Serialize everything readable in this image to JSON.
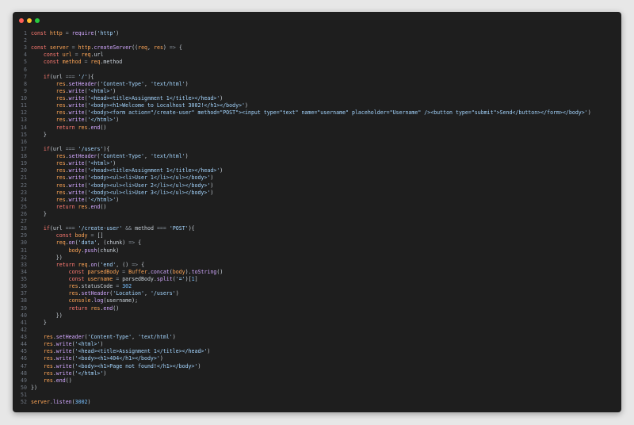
{
  "window": {
    "controls": {
      "close_color": "#ff5f56",
      "minimize_color": "#ffbd2e",
      "maximize_color": "#27c93f"
    }
  },
  "editor": {
    "lines": [
      "const http = require('http')",
      "",
      "const server = http.createServer((req, res) => {",
      "    const url = req.url",
      "    const method = req.method",
      "",
      "    if(url === '/'){",
      "        res.setHeader('Content-Type', 'text/html')",
      "        res.write('<html>')",
      "        res.write('<head><title>Assignment 1</title></head>')",
      "        res.write('<body><h1>Welcome to Localhost 3002!</h1></body>')",
      "        res.write('<body><form action=\"/create-user\" method=\"POST\"><input type=\"text\" name=\"username\" placeholder=\"Username\" /><button type=\"submit\">Send</button></form></body>')",
      "        res.write('</html>')",
      "        return res.end()",
      "    }",
      "",
      "    if(url === '/users'){",
      "        res.setHeader('Content-Type', 'text/html')",
      "        res.write('<html>')",
      "        res.write('<head><title>Assignment 1</title></head>')",
      "        res.write('<body><ul><li>User 1</li></ul></body>')",
      "        res.write('<body><ul><li>User 2</li></ul></body>')",
      "        res.write('<body><ul><li>User 3</li></ul></body>')",
      "        res.write('</html>')",
      "        return res.end()",
      "    }",
      "",
      "    if(url === '/create-user' && method === 'POST'){",
      "        const body = []",
      "        req.on('data', (chunk) => {",
      "            body.push(chunk)",
      "        })",
      "        return req.on('end', () => {",
      "            const parsedBody = Buffer.concat(body).toString()",
      "            const username = parsedBody.split('=')[1]",
      "            res.statusCode = 302",
      "            res.setHeader('Location', '/users')",
      "            console.log(username);",
      "            return res.end()",
      "        })",
      "    }",
      "",
      "    res.setHeader('Content-Type', 'text/html')",
      "    res.write('<html>')",
      "    res.write('<head><title>Assignment 1</title></head>')",
      "    res.write('<body><h1>404</h1></body>')",
      "    res.write('<body><h1>Page not found!</h1></body>')",
      "    res.write('</html>')",
      "    res.end()",
      "})",
      "",
      "server.listen(3002)"
    ],
    "syntax_colors": {
      "background": "#1e1e1e",
      "text": "#c9d1d9",
      "line_number": "#6e7681",
      "keyword": "#ff7b72",
      "function": "#d2a8ff",
      "string": "#a5d6ff",
      "number": "#79c0ff",
      "variable": "#ffa657",
      "operator": "#8b949e"
    }
  }
}
